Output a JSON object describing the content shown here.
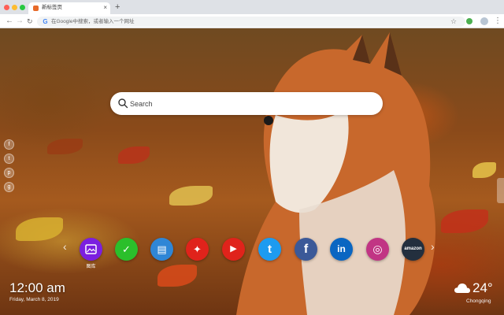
{
  "browser": {
    "tab_title": "新标签页",
    "tab_close": "×",
    "new_tab": "+",
    "back": "←",
    "forward": "→",
    "reload": "↻",
    "omnibox_text": "在Google中搜索，或者输入一个网址",
    "google_glyph": "G",
    "star_glyph": "☆",
    "menu_glyph": "⋮"
  },
  "search": {
    "placeholder": "Search"
  },
  "social_links": [
    {
      "name": "facebook",
      "glyph": "f"
    },
    {
      "name": "twitter",
      "glyph": "t"
    },
    {
      "name": "pinterest",
      "glyph": "p"
    },
    {
      "name": "google-plus",
      "glyph": "g"
    }
  ],
  "dock": {
    "prev": "‹",
    "next": "›",
    "apps": [
      {
        "name": "wallpaper",
        "label": "图库",
        "color": "#7b1fe0",
        "glyph": ""
      },
      {
        "name": "checklist",
        "label": "",
        "color": "#2bbf2b",
        "glyph": "✓"
      },
      {
        "name": "notes",
        "label": "",
        "color": "#2f86d6",
        "glyph": "▤"
      },
      {
        "name": "games",
        "label": "",
        "color": "#e0231b",
        "glyph": "✦"
      },
      {
        "name": "youtube",
        "label": "",
        "color": "#e0231b",
        "glyph": "▶"
      },
      {
        "name": "twitter",
        "label": "",
        "color": "#1d9bf0",
        "glyph": "t"
      },
      {
        "name": "facebook",
        "label": "",
        "color": "#3b5998",
        "glyph": "f"
      },
      {
        "name": "linkedin",
        "label": "",
        "color": "#0a66c2",
        "glyph": "in"
      },
      {
        "name": "instagram",
        "label": "",
        "color": "#c13584",
        "glyph": "◎"
      },
      {
        "name": "amazon",
        "label": "",
        "color": "#232f3e",
        "glyph": "amazon"
      }
    ]
  },
  "clock": {
    "time": "12:00 am",
    "date": "Friday, March 8, 2019"
  },
  "weather": {
    "temperature": "24°",
    "city": "Chongqing"
  }
}
